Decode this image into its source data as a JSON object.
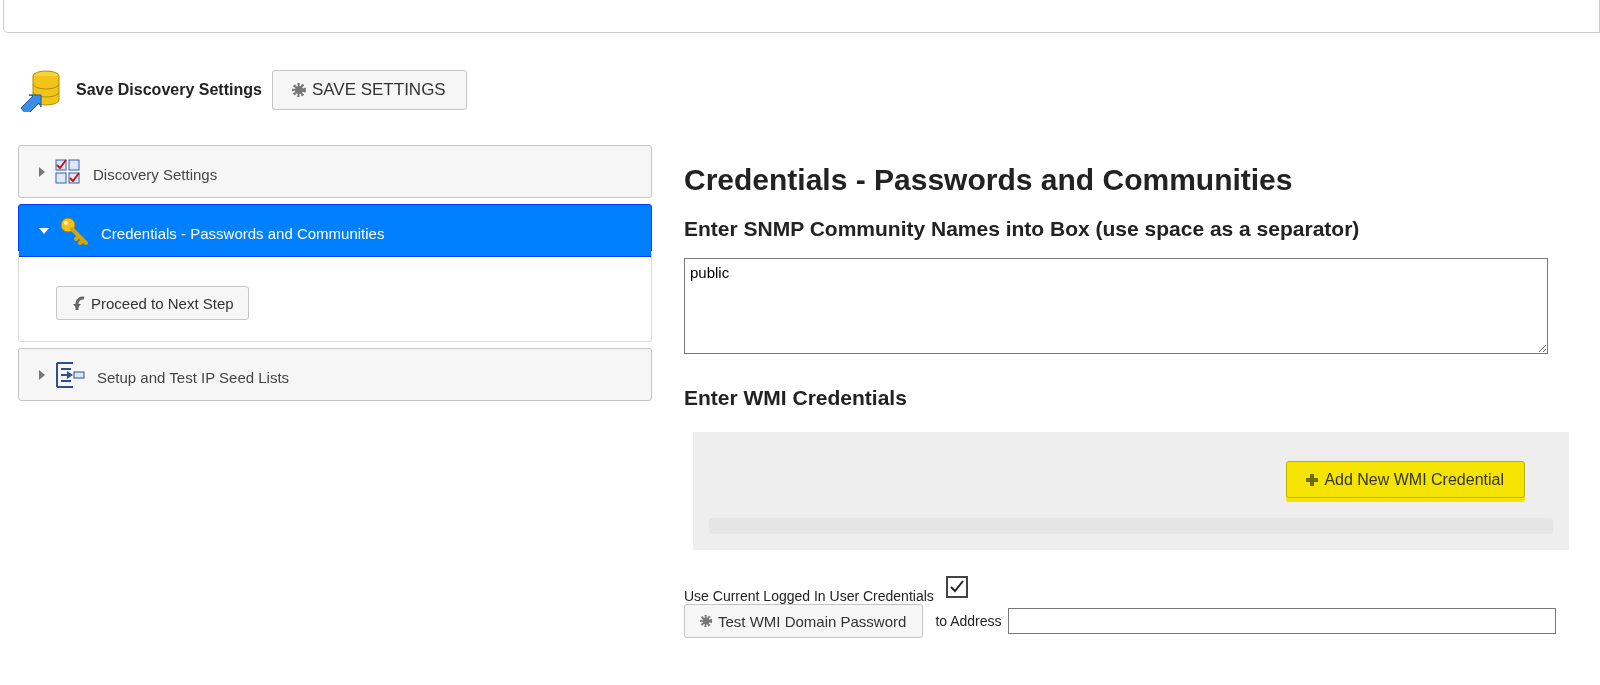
{
  "header": {
    "title": "Save Discovery Settings",
    "save_button": "SAVE SETTINGS"
  },
  "accordion": [
    {
      "kind": "checklist",
      "label": "Discovery Settings",
      "expanded": false
    },
    {
      "kind": "key",
      "label": "Credentials - Passwords and Communities",
      "expanded": true,
      "button": "Proceed to Next Step"
    },
    {
      "kind": "tree",
      "label": "Setup and Test IP Seed Lists",
      "expanded": false
    }
  ],
  "content": {
    "title": "Credentials - Passwords and Communities",
    "snmp_heading": "Enter SNMP Community Names into Box (use space as a separator)",
    "snmp_value": "public",
    "wmi_heading": "Enter WMI Credentials",
    "add_button": "Add New WMI Credential",
    "use_current_label": "Use Current Logged In User Credentials",
    "use_current_checked": true,
    "test_button": "Test WMI Domain Password",
    "address_label": "to Address"
  }
}
